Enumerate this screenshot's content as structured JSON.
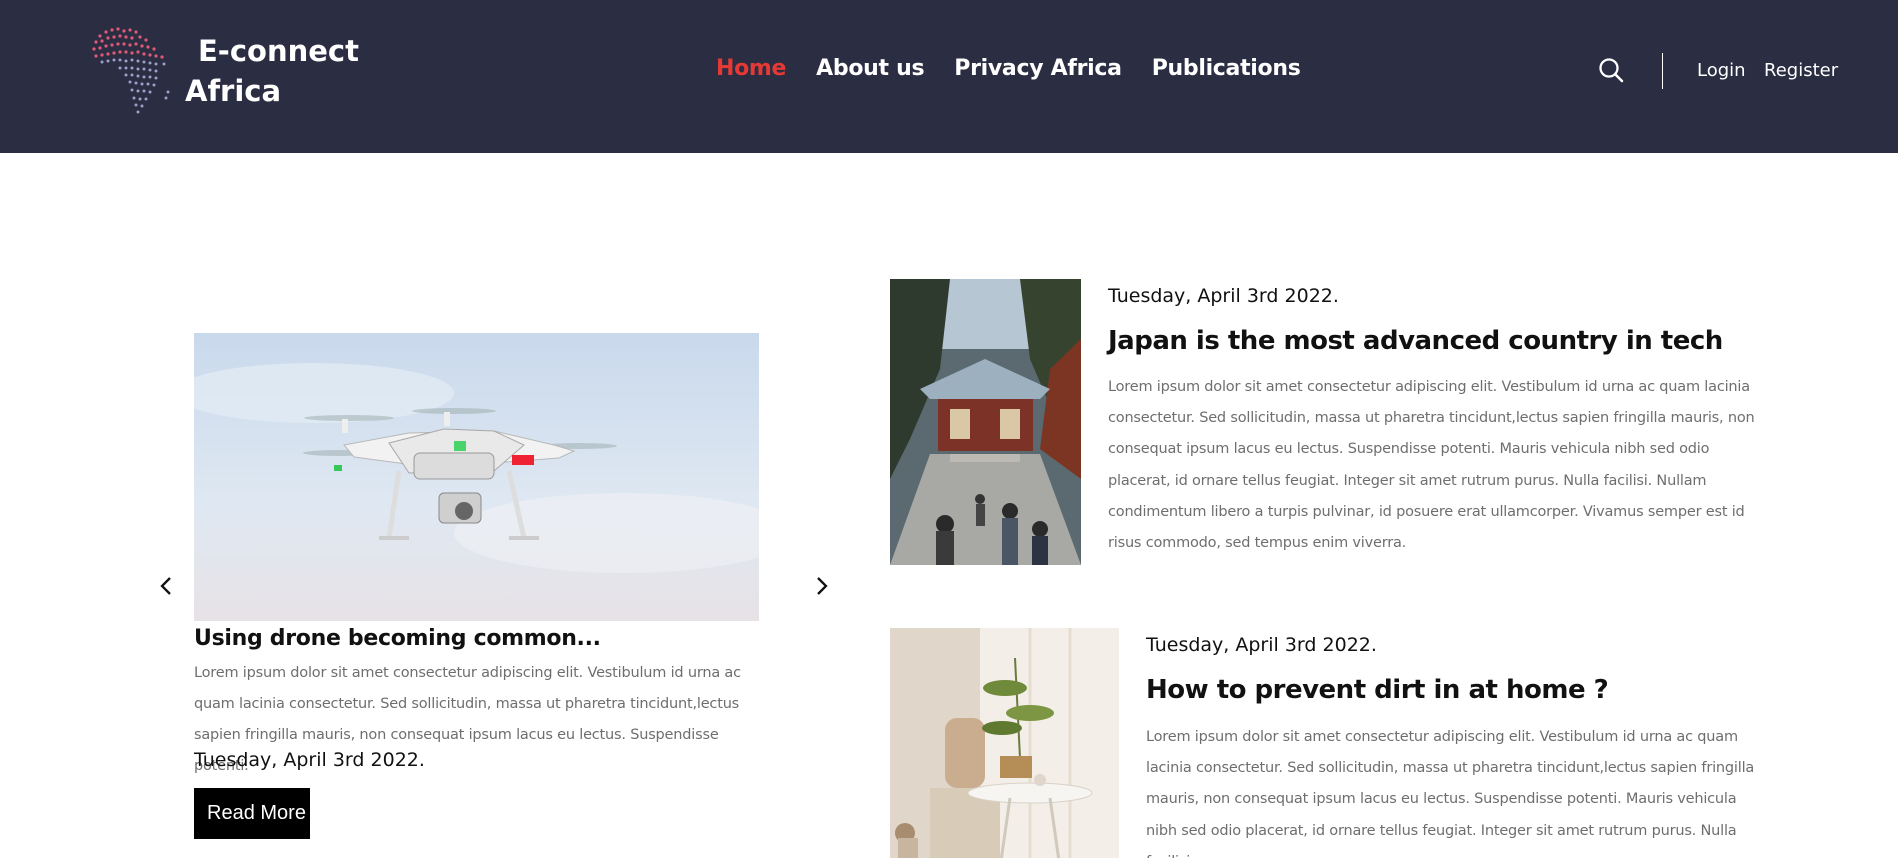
{
  "header": {
    "logo_line1": "E-connect",
    "logo_line2": "Africa",
    "nav": [
      {
        "label": "Home",
        "active": true
      },
      {
        "label": "About us",
        "active": false
      },
      {
        "label": "Privacy Africa",
        "active": false
      },
      {
        "label": "Publications",
        "active": false
      }
    ],
    "login_label": "Login",
    "register_label": "Register",
    "search_icon": "search-icon",
    "bg_color": "#2b2d42",
    "active_color": "#e53935"
  },
  "carousel": {
    "prev_icon": "chevron-left-icon",
    "next_icon": "chevron-right-icon",
    "image": "drone-photo",
    "title": "Using drone becoming common...",
    "description": "Lorem ipsum dolor sit amet consectetur adipiscing elit. Vestibulum id urna ac quam lacinia consectetur. Sed sollicitudin, massa ut pharetra tincidunt,lectus sapien fringilla mauris, non consequat ipsum lacus eu lectus. Suspendisse potenti.",
    "date": "Tuesday, April 3rd 2022.",
    "read_more_label": "Read More"
  },
  "articles": [
    {
      "image": "japan-temple-photo",
      "date": "Tuesday, April 3rd 2022.",
      "title": "Japan is the most advanced country in tech",
      "body": "Lorem ipsum dolor sit amet consectetur adipiscing elit. Vestibulum id urna ac quam lacinia consectetur. Sed sollicitudin, massa ut pharetra tincidunt,lectus sapien fringilla mauris, non consequat ipsum lacus eu lectus. Suspendisse potenti. Mauris vehicula nibh sed odio placerat, id ornare tellus feugiat. Integer sit amet rutrum purus. Nulla facilisi. Nullam condimentum libero a turpis pulvinar, id posuere erat ullamcorper. Vivamus semper est id risus commodo, sed tempus enim viverra."
    },
    {
      "image": "home-interior-photo",
      "date": "Tuesday, April 3rd 2022.",
      "title": "How to prevent dirt in at home ?",
      "body": "Lorem ipsum dolor sit amet consectetur adipiscing elit. Vestibulum id urna ac quam lacinia consectetur. Sed sollicitudin, massa ut pharetra tincidunt,lectus sapien fringilla mauris, non consequat ipsum lacus eu lectus. Suspendisse potenti. Mauris vehicula nibh sed odio placerat, id ornare tellus feugiat. Integer sit amet rutrum purus. Nulla facilisi."
    }
  ]
}
